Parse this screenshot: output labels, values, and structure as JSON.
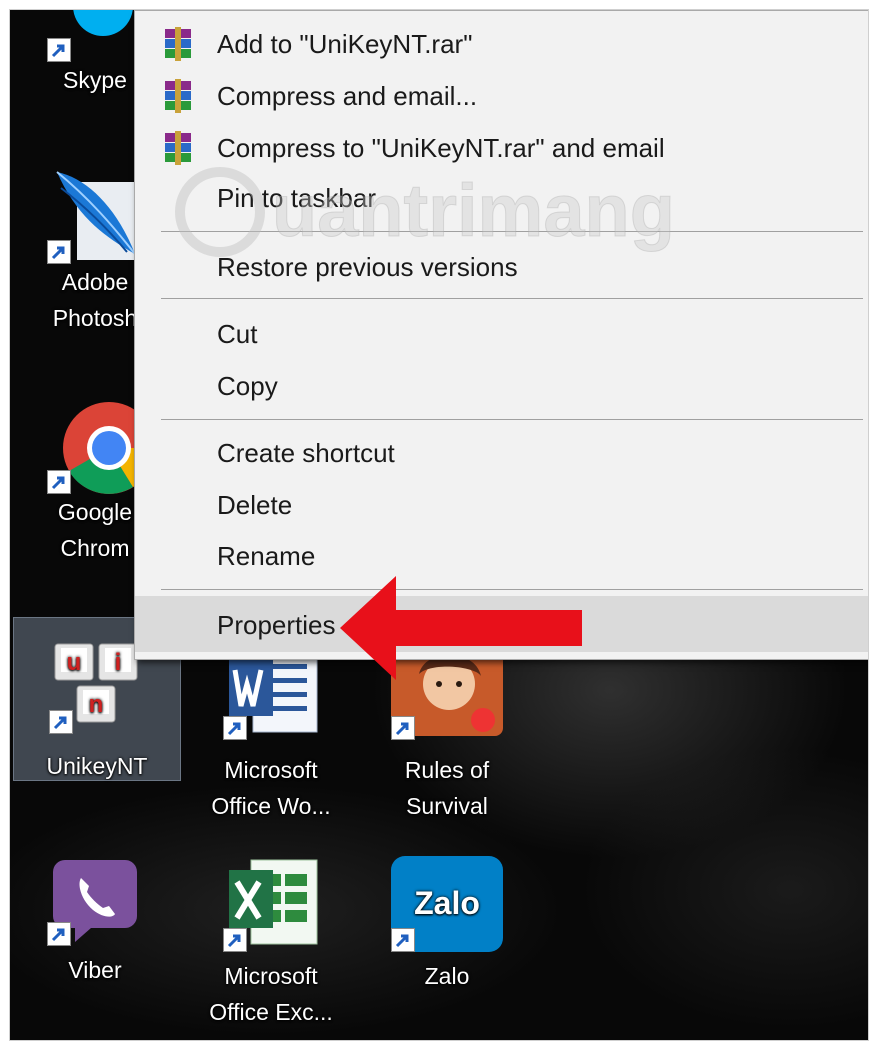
{
  "context_menu": {
    "items": [
      {
        "label": "Add to \"UniKeyNT.rar\"",
        "icon": "winrar-icon"
      },
      {
        "label": "Compress and email...",
        "icon": "winrar-icon"
      },
      {
        "label": "Compress to \"UniKeyNT.rar\" and email",
        "icon": "winrar-icon"
      },
      {
        "label": "Pin to taskbar"
      },
      {
        "label": "Restore previous versions"
      },
      {
        "label": "Cut"
      },
      {
        "label": "Copy"
      },
      {
        "label": "Create shortcut"
      },
      {
        "label": "Delete"
      },
      {
        "label": "Rename"
      },
      {
        "label": "Properties",
        "highlighted": true
      }
    ]
  },
  "desktop": {
    "icons": [
      {
        "name": "skype",
        "label_lines": [
          "Skype",
          ""
        ]
      },
      {
        "name": "adobe-photoshop",
        "label_lines": [
          "Adobe",
          "Photosh"
        ]
      },
      {
        "name": "google-chrome",
        "label_lines": [
          "Google",
          "Chrom"
        ]
      },
      {
        "name": "unikeynt",
        "label_lines": [
          "UnikeyNT",
          ""
        ],
        "selected": true
      },
      {
        "name": "microsoft-office-word",
        "label_lines": [
          "Microsoft",
          "Office Wo..."
        ]
      },
      {
        "name": "rules-of-survival",
        "label_lines": [
          "Rules of",
          "Survival"
        ]
      },
      {
        "name": "viber",
        "label_lines": [
          "Viber",
          ""
        ]
      },
      {
        "name": "microsoft-office-excel",
        "label_lines": [
          "Microsoft",
          "Office Exc..."
        ]
      },
      {
        "name": "zalo",
        "label_lines": [
          "Zalo",
          ""
        ]
      }
    ],
    "unikey_letters": [
      "u",
      "i",
      "n"
    ],
    "zalo_logo_text": "Zalo"
  },
  "watermark": {
    "text": "uantrimang"
  },
  "colors": {
    "menu_bg": "#f2f2f2",
    "highlight": "#dadada",
    "arrow": "#e8101a"
  }
}
